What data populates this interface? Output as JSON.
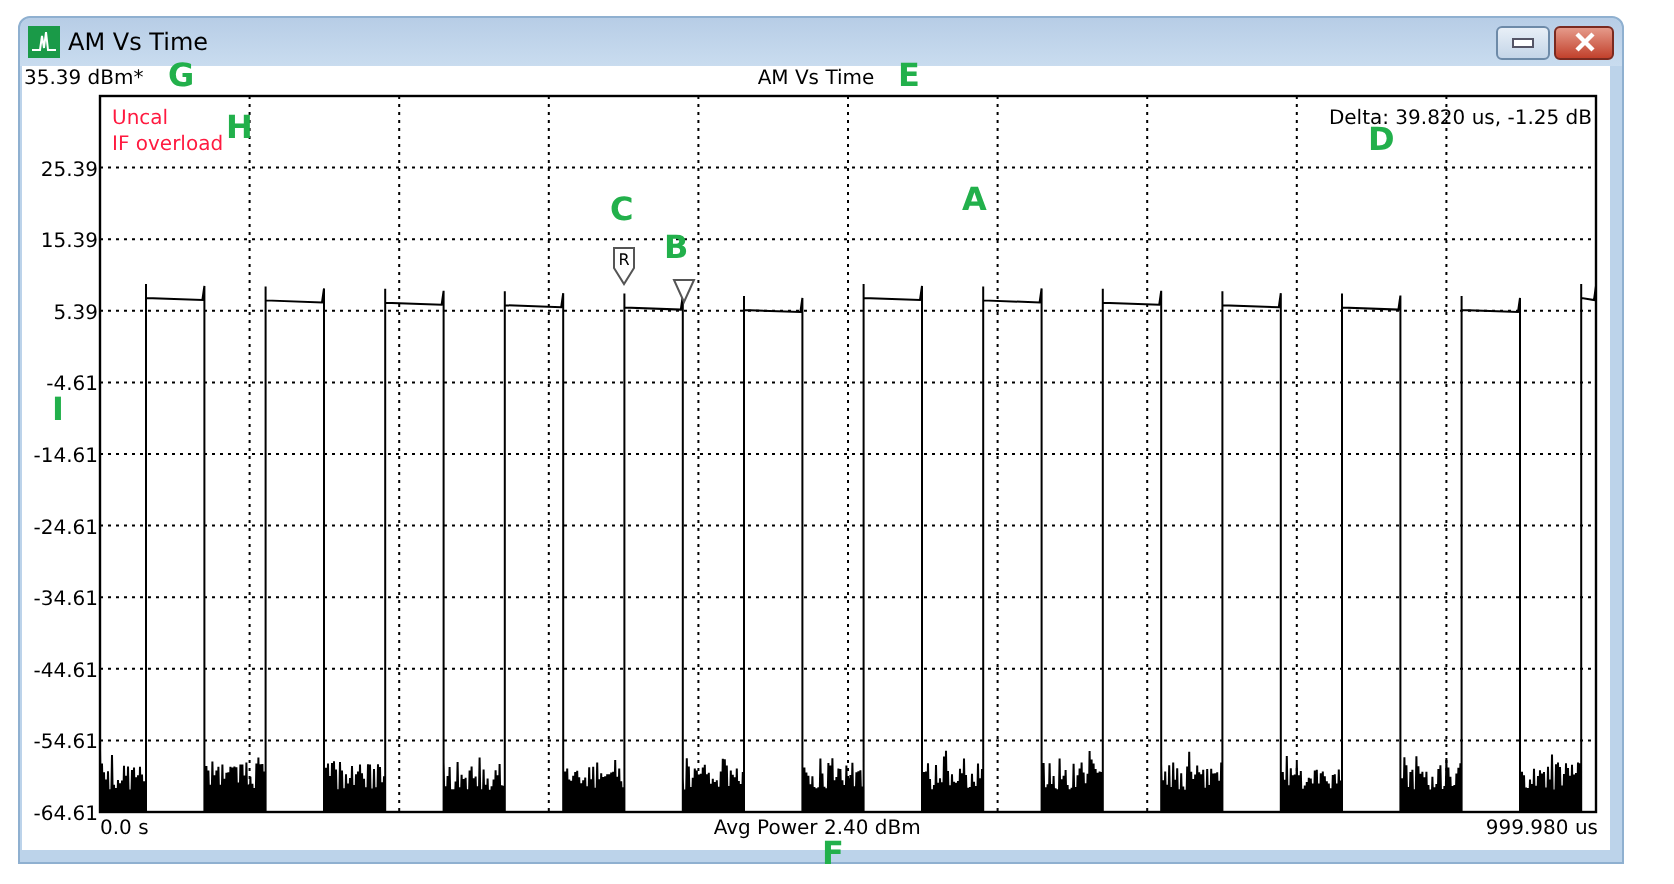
{
  "window": {
    "title": "AM Vs Time"
  },
  "header": {
    "reference_level": "35.39 dBm*",
    "title": "AM Vs Time"
  },
  "plot": {
    "status_lines": [
      "Uncal",
      "IF overload"
    ],
    "delta_readout": "Delta: 39.820 us, -1.25 dB",
    "y_ticks": [
      "25.39",
      "15.39",
      "5.39",
      "-4.61",
      "-14.61",
      "-24.61",
      "-34.61",
      "-44.61",
      "-54.61",
      "-64.61"
    ],
    "markers": [
      {
        "kind": "reference",
        "label": "R"
      },
      {
        "kind": "delta"
      }
    ]
  },
  "footer": {
    "start": "0.0 s",
    "center": "Avg Power 2.40 dBm",
    "stop": "999.980 us"
  },
  "callouts": [
    {
      "letter": "G"
    },
    {
      "letter": "E"
    },
    {
      "letter": "H"
    },
    {
      "letter": "D"
    },
    {
      "letter": "C"
    },
    {
      "letter": "A"
    },
    {
      "letter": "B"
    },
    {
      "letter": "I"
    },
    {
      "letter": "F"
    }
  ]
}
